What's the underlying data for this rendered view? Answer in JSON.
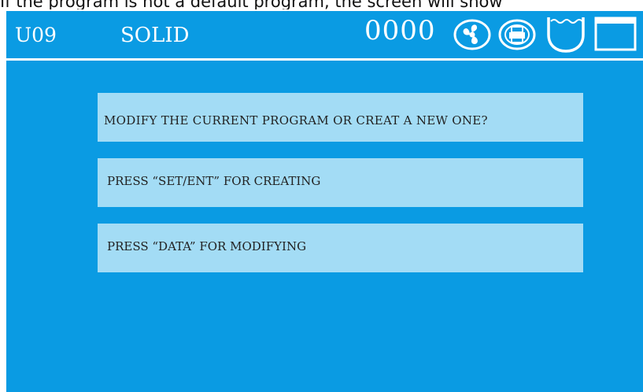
{
  "caption": "If the program is not a default program, the screen will show",
  "header": {
    "mode": "U09",
    "material": "SOLID",
    "counter": "0000",
    "icons": [
      "fan-icon",
      "print-icon",
      "bath-icon",
      "window-icon"
    ]
  },
  "dialog": {
    "question": "MODIFY THE CURRENT PROGRAM OR CREAT A NEW ONE?",
    "create_instruction": "PRESS “SET/ENT” FOR CREATING",
    "modify_instruction": "PRESS “DATA” FOR MODIFYING"
  },
  "colors": {
    "screen_background": "#0a9be3",
    "message_box": "#a3dcf5",
    "header_text": "#ffffff"
  }
}
